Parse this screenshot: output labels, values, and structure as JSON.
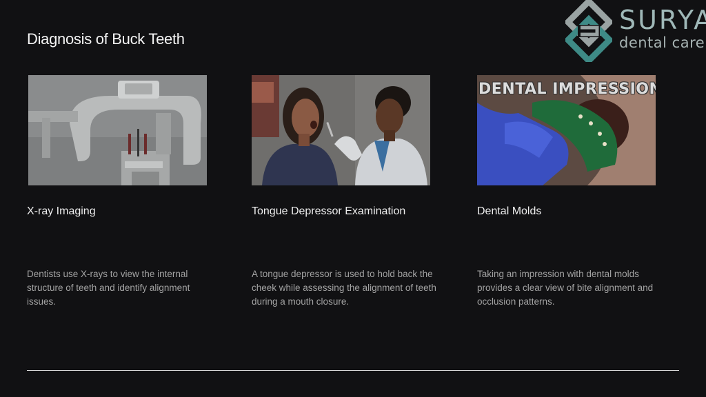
{
  "slide": {
    "title": "Diagnosis of Buck Teeth"
  },
  "logo": {
    "name": "SURYA",
    "tagline": "dental care",
    "icon": "surya-logo-mark-icon",
    "colors": {
      "teal": "#3e8a86",
      "grey": "#9aa3a3"
    }
  },
  "cards": [
    {
      "title": "X-ray Imaging",
      "description": "Dentists use X-rays to view the internal structure of teeth and identify alignment issues.",
      "image": "dental-xray-machine-photo"
    },
    {
      "title": "Tongue Depressor Examination",
      "description": "A tongue depressor is used to hold back the cheek while assessing the alignment of teeth during a mouth closure.",
      "image": "dentist-examining-patient-photo"
    },
    {
      "title": "Dental Molds",
      "description": "Taking an impression with dental molds provides a clear view of bite alignment and occlusion patterns.",
      "image": "dental-impression-tray-photo",
      "image_caption": "DENTAL IMPRESSIONS"
    }
  ],
  "colors": {
    "background": "#111113",
    "title": "#f4f4f4",
    "body_text": "#a3a3a3",
    "divider": "#d9d9d9"
  }
}
